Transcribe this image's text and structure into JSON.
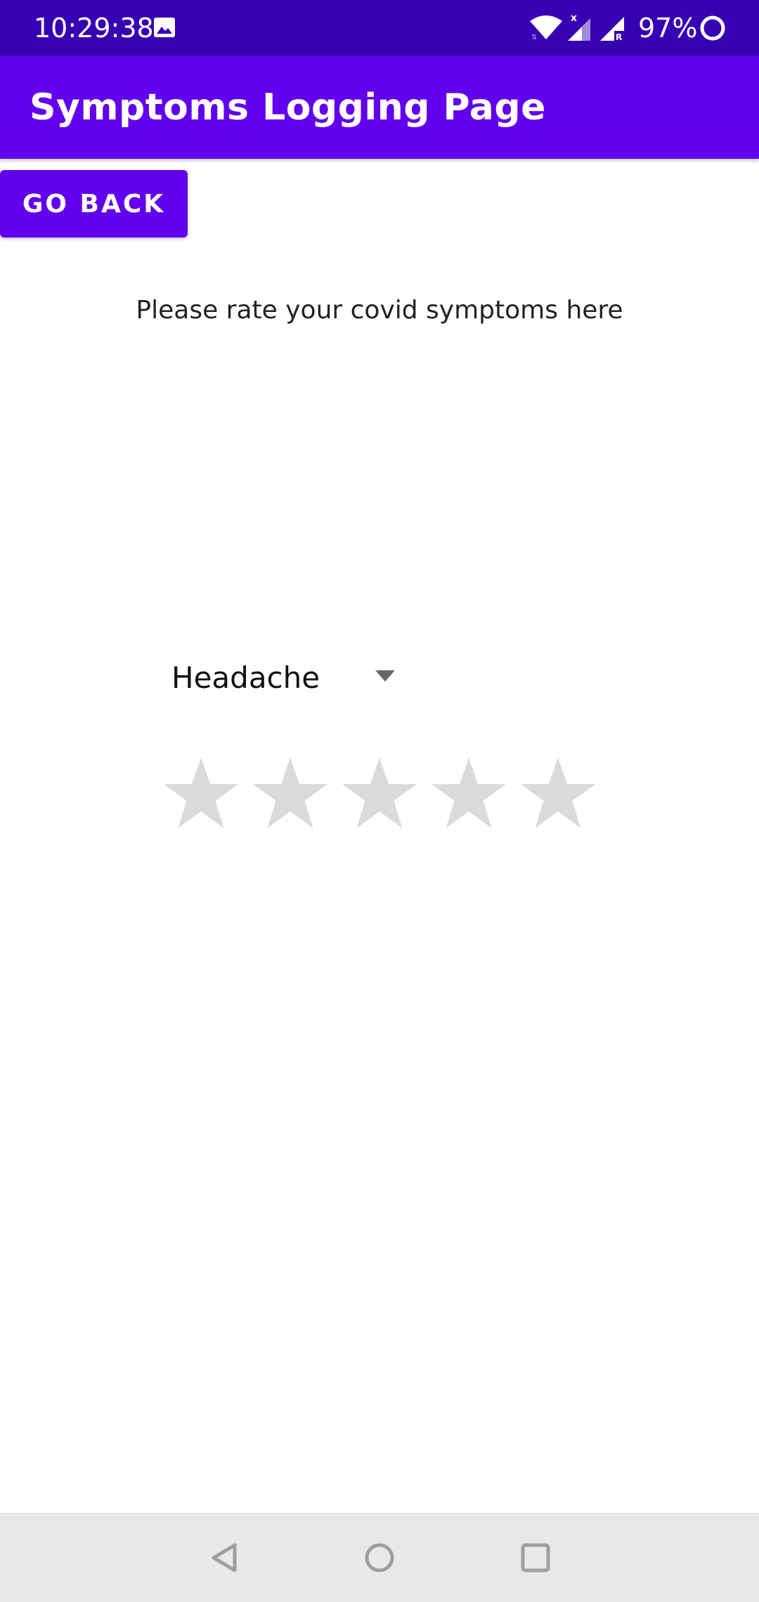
{
  "status_bar": {
    "time": "10:29:38",
    "battery": "97%",
    "icons": [
      "gallery-icon",
      "wifi-icon",
      "cell-signal-icon",
      "roaming-signal-icon",
      "battery-saver-icon"
    ]
  },
  "app_bar": {
    "title": "Symptoms Logging Page"
  },
  "actions": {
    "go_back_label": "GO BACK"
  },
  "main": {
    "prompt": "Please rate your covid symptoms here",
    "symptom_dropdown": {
      "selected": "Headache"
    },
    "rating": {
      "max_stars": 5,
      "value": 0
    }
  },
  "nav_bar": {
    "icons": [
      "back-icon",
      "home-icon",
      "recents-icon"
    ]
  },
  "colors": {
    "status_bar": "#3700b3",
    "primary": "#6200ee",
    "star_empty": "#dadada",
    "nav_bar": "#e8e8e8"
  }
}
